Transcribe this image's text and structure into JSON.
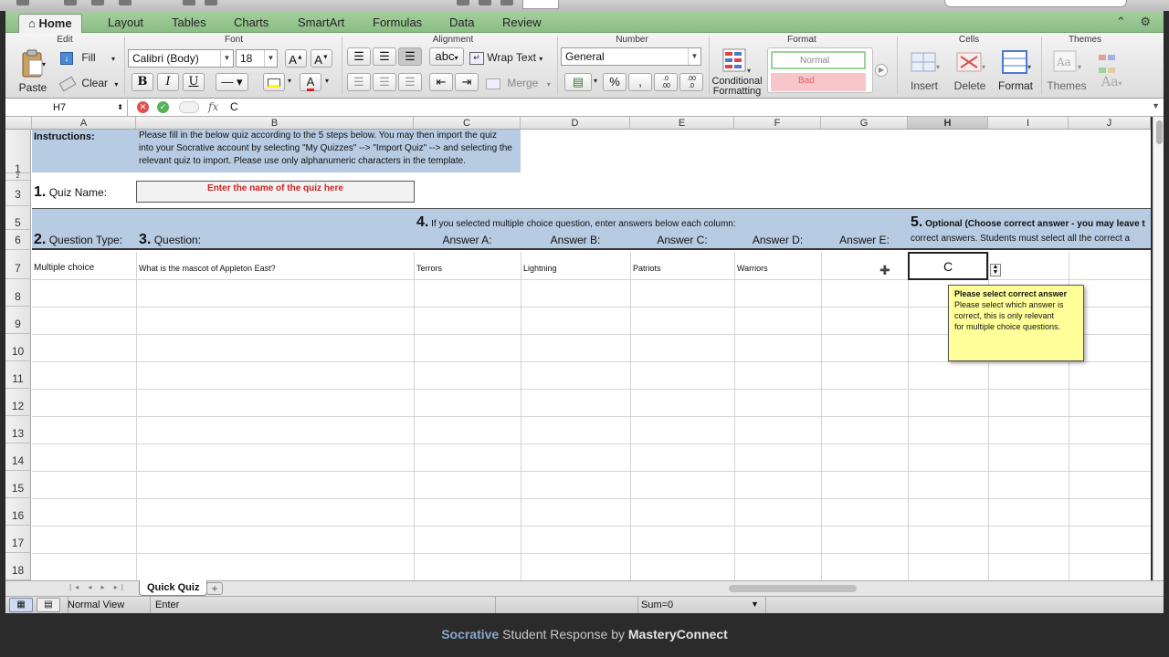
{
  "ribbon": {
    "tabs": [
      "Home",
      "Layout",
      "Tables",
      "Charts",
      "SmartArt",
      "Formulas",
      "Data",
      "Review"
    ],
    "active_tab": "Home",
    "groups": {
      "edit": "Edit",
      "font": "Font",
      "alignment": "Alignment",
      "number": "Number",
      "format": "Format",
      "cells": "Cells",
      "themes": "Themes"
    },
    "paste_label": "Paste",
    "fill_label": "Fill",
    "clear_label": "Clear",
    "font_name": "Calibri (Body)",
    "font_size": "18",
    "wrap_text_label": "Wrap Text",
    "merge_label": "Merge",
    "number_format": "General",
    "percent_symbol": "%",
    "conditional_formatting_label": "Conditional Formatting",
    "style_normal": "Normal",
    "style_bad": "Bad",
    "insert_label": "Insert",
    "delete_label": "Delete",
    "format_label": "Format",
    "themes_label": "Themes",
    "bold": "B",
    "italic": "I",
    "underline": "U",
    "wrap_abc": "abc",
    "dec_inc": ".0\n.00",
    "dec_dec": ".00\n.0",
    "themes_aa": "Aa"
  },
  "formula_bar": {
    "cell_ref": "H7",
    "fx": "fx",
    "value": "C"
  },
  "columns": [
    "A",
    "B",
    "C",
    "D",
    "E",
    "F",
    "G",
    "H",
    "I",
    "J"
  ],
  "selected_column": "H",
  "rows": [
    "1",
    "2",
    "3",
    "5",
    "6",
    "7",
    "8",
    "9",
    "10",
    "11",
    "12",
    "13",
    "14",
    "15",
    "16",
    "17",
    "18"
  ],
  "sheet": {
    "instructions_label": "Instructions:",
    "instructions_text_1": "Please fill in the below quiz according to the 5 steps below. You may then import the quiz",
    "instructions_text_2": "into your Socrative account by selecting \"My Quizzes\" --> \"Import Quiz\" --> and selecting the",
    "instructions_text_3": "relevant quiz to import. Please use only alphanumeric characters in the template.",
    "step1_num": "1.",
    "step1_label": "Quiz Name:",
    "quiz_name_placeholder": "Enter the name of the quiz here",
    "step4_num": "4.",
    "step4_text": "If you selected multiple choice question, enter answers below each column:",
    "step5_num": "5.",
    "step5_text": "Optional (Choose correct answer - you may leave t",
    "step5_text_2": "correct answers.  Students must select all the correct a",
    "step2_num": "2.",
    "step2_label": "Question Type:",
    "step3_num": "3.",
    "step3_label": "Question:",
    "answer_headers": [
      "Answer A:",
      "Answer B:",
      "Answer C:",
      "Answer D:",
      "Answer E:"
    ],
    "row7": {
      "type": "Multiple choice",
      "question": "What is the mascot of Appleton East?",
      "answers": [
        "Terrors",
        "Lightning",
        "Patriots",
        "Warriors"
      ],
      "correct": "C"
    }
  },
  "tooltip": {
    "title": "Please select correct answer",
    "body_1": "Please select which answer is",
    "body_2": "correct, this is only relevant",
    "body_3": "for multiple choice questions."
  },
  "sheet_tabs": [
    "Quick Quiz"
  ],
  "add_sheet": "+",
  "status": {
    "view": "Normal View",
    "mode": "Enter",
    "sum": "Sum=0"
  },
  "footer": {
    "brand": "Socrative",
    "middle": " Student Response by ",
    "company": "MasteryConnect"
  },
  "colors": {
    "ribbon_green": "#8dbd86",
    "header_band": "#b7cbe2",
    "tooltip_bg": "#ffff99",
    "placeholder_red": "#cc2222"
  }
}
